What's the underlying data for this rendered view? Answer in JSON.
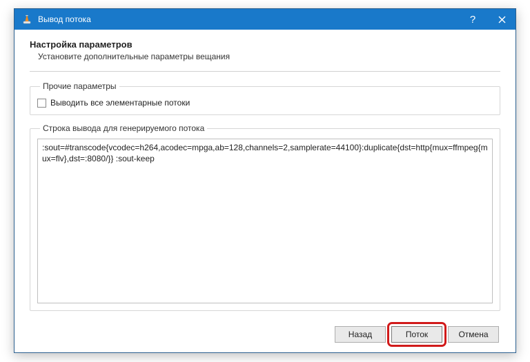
{
  "window": {
    "title": "Вывод потока"
  },
  "heading": "Настройка параметров",
  "subheading": "Установите дополнительные параметры вещания",
  "groups": {
    "misc": {
      "legend": "Прочие параметры",
      "checkbox_label": "Выводить все элементарные потоки"
    },
    "output": {
      "legend": "Строка вывода для генерируемого потока",
      "value": ":sout=#transcode{vcodec=h264,acodec=mpga,ab=128,channels=2,samplerate=44100}:duplicate{dst=http{mux=ffmpeg{mux=flv},dst=:8080/}} :sout-keep"
    }
  },
  "buttons": {
    "back": "Назад",
    "stream": "Поток",
    "cancel": "Отмена"
  },
  "icons": {
    "help": "?",
    "close": "close"
  }
}
